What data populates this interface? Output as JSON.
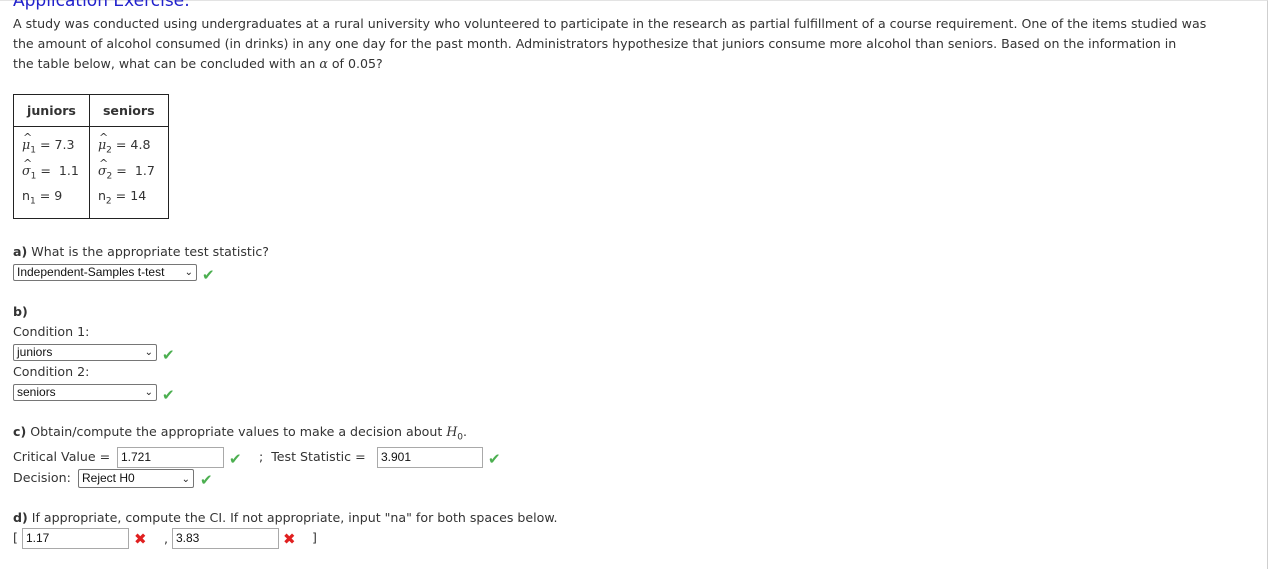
{
  "title": "Application Exercise:",
  "intro": {
    "line1": "A study was conducted using undergraduates at a rural university who volunteered to participate in the research as partial fulfillment of a course requirement.  One of the items studied was",
    "line2": "the amount of alcohol consumed (in drinks) in any one day for the past month.  Administrators hypothesize that juniors consume more alcohol than seniors.  Based on the information in",
    "line3_pre": "the table below, what can be concluded with an ",
    "alpha_symbol": "α",
    "line3_post": " of 0.05?"
  },
  "table": {
    "headers": [
      "juniors",
      "seniors"
    ],
    "groups": [
      {
        "mu_label": "μ",
        "mu_sub": "1",
        "mu_value": "= 7.3",
        "sigma_label": "σ",
        "sigma_sub": "1",
        "sigma_value": "=  1.1",
        "n_label": "n",
        "n_sub": "1",
        "n_value": "= 9"
      },
      {
        "mu_label": "μ",
        "mu_sub": "2",
        "mu_value": "= 4.8",
        "sigma_label": "σ",
        "sigma_sub": "2",
        "sigma_value": "=  1.7",
        "n_label": "n",
        "n_sub": "2",
        "n_value": "= 14"
      }
    ]
  },
  "part_a": {
    "label": "a)",
    "question": " What is the appropriate test statistic?",
    "selected": "Independent-Samples t-test",
    "status": "correct"
  },
  "part_b": {
    "label": "b)",
    "condition1_label": "Condition 1:",
    "condition1_selected": "juniors",
    "condition1_status": "correct",
    "condition2_label": "Condition 2:",
    "condition2_selected": "seniors",
    "condition2_status": "correct"
  },
  "part_c": {
    "label": "c)",
    "question": " Obtain/compute the appropriate values to make a decision about ",
    "h0_main": "H",
    "h0_sub": "0",
    "h0_end": ".",
    "critical_label": "Critical Value = ",
    "critical_value": "1.721",
    "critical_status": "correct",
    "separator": ";  Test Statistic = ",
    "test_statistic_value": "3.901",
    "test_statistic_status": "correct",
    "decision_label": "Decision:",
    "decision_selected": "Reject H0",
    "decision_status": "correct"
  },
  "part_d": {
    "label": "d)",
    "question": " If appropriate, compute the CI. If not appropriate, input \"na\" for both spaces below.",
    "open_bracket": "[",
    "lower_value": "1.17",
    "lower_status": "incorrect",
    "comma": ",",
    "upper_value": "3.83",
    "upper_status": "incorrect",
    "close_bracket": "]"
  },
  "icons": {
    "correct": "✔",
    "incorrect": "✖",
    "dropdown": "⌄"
  },
  "colors": {
    "title": "#2222cc",
    "correct": "#4caf50",
    "incorrect": "#e02020"
  }
}
